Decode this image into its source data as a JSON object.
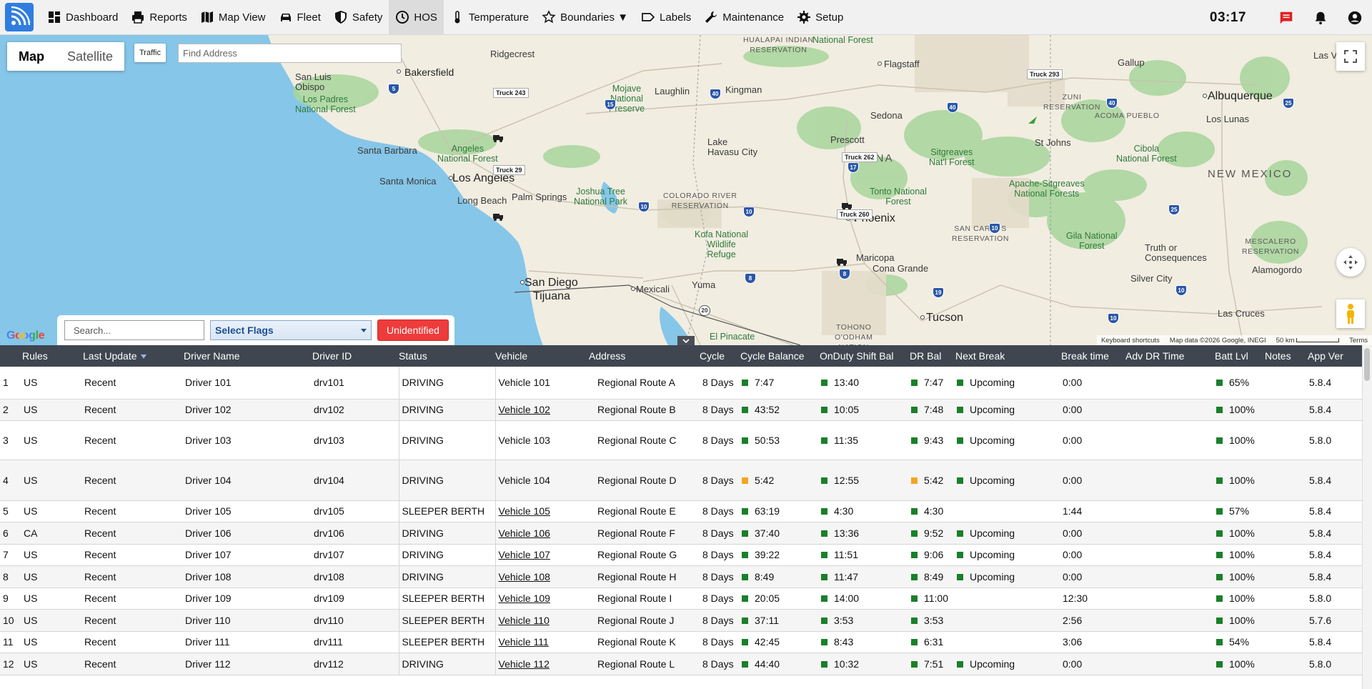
{
  "nav": {
    "items": [
      {
        "id": "dashboard",
        "label": "Dashboard",
        "icon": "dashboard-icon"
      },
      {
        "id": "reports",
        "label": "Reports",
        "icon": "printer-icon"
      },
      {
        "id": "mapview",
        "label": "Map View",
        "icon": "map-icon"
      },
      {
        "id": "fleet",
        "label": "Fleet",
        "icon": "car-icon"
      },
      {
        "id": "safety",
        "label": "Safety",
        "icon": "shield-icon"
      },
      {
        "id": "hos",
        "label": "HOS",
        "icon": "clock-icon"
      },
      {
        "id": "temperature",
        "label": "Temperature",
        "icon": "thermometer-icon"
      },
      {
        "id": "boundaries",
        "label": "Boundaries ▼",
        "icon": "star-icon"
      },
      {
        "id": "labels",
        "label": "Labels",
        "icon": "label-icon"
      },
      {
        "id": "maintenance",
        "label": "Maintenance",
        "icon": "wrench-icon"
      },
      {
        "id": "setup",
        "label": "Setup",
        "icon": "gear-icon"
      }
    ],
    "active": "hos",
    "clock": "03:17",
    "accent": "#2f7de1"
  },
  "map": {
    "toggle": {
      "map": "Map",
      "satellite": "Satellite"
    },
    "traffic": "Traffic",
    "find_address_placeholder": "Find Address",
    "google": "Google",
    "attribution": {
      "shortcuts": "Keyboard shortcuts",
      "data": "Map data ©2026 Google, INEGI",
      "scale": "50 km",
      "terms": "Terms"
    },
    "trucks": [
      {
        "name": "Truck 243"
      },
      {
        "name": "Truck 29"
      },
      {
        "name": "Truck 293"
      },
      {
        "name": "Truck 262"
      },
      {
        "name": "Truck 260"
      }
    ],
    "labels": {
      "bakersfield": "Bakersfield",
      "ridgecrest": "Ridgecrest",
      "sanluis": "San Luis\nObispo",
      "lospadres": "Los Padres\nNational Forest",
      "santabarbara": "Santa Barbara",
      "angeles": "Angeles\nNational Forest",
      "losangeles": "Los Angeles",
      "santamonica": "Santa Monica",
      "longbeach": "Long Beach",
      "palmsprings": "Palm Springs",
      "joshua": "Joshua Tree\nNational Park",
      "mojave": "Mojave\nNational\nPreserve",
      "laughlin": "Laughlin",
      "kingman": "Kingman",
      "lakehavasu": "Lake\nHavasu City",
      "coloradoriver": "COLORADO RIVER\nRESERVATION",
      "kofa": "Kofa National\nWildlife\nRefuge",
      "sandiego": "San Diego",
      "tijuana": "Tijuana",
      "mexicali": "Mexicali",
      "yuma": "Yuma",
      "elpinacate": "El Pinacate",
      "hualapai": "HUALAPAI INDIAN\nRESERVATION",
      "flagstaff": "Flagstaff",
      "sedona": "Sedona",
      "prescott": "Prescott",
      "arizona": "ONA",
      "tonto": "Tonto National\nForest",
      "sitgreaves": "Sitgreaves\nNat'l Forest",
      "phoenix": "Phoenix",
      "maricopa": "Maricopa",
      "casagrande": "Cona Grande",
      "tucson": "Tucson",
      "tohono": "TOHONO\nO'ODHAM\nNATION",
      "sancarlos": "SAN CARLOS\nRESERVATION",
      "apache": "Apache-Sitgreaves\nNational Forests",
      "stjohns": "St Johns",
      "zuni": "ZUNI\nRESERVATION",
      "gallup": "Gallup",
      "acomapueblo": "ACOMA PUEBLO",
      "albuquerque": "Albuquerque",
      "loslunas": "Los Lunas",
      "cibola": "Cibola\nNational Forest",
      "newmexico": "NEW MEXICO",
      "gila": "Gila National\nForest",
      "truth": "Truth or\nConsequences",
      "silvercity": "Silver City",
      "lascruces": "Las Cruces",
      "mescalero": "MESCALERO\nRESERVATION",
      "alamogordo": "Alamogordo",
      "nationalforest": "National Forest",
      "reservation": "RESERVATION",
      "lasvegas": "Las Vega"
    },
    "highways": [
      "5",
      "40",
      "15",
      "10",
      "8",
      "17",
      "19",
      "25",
      "20",
      "40",
      "10",
      "17"
    ]
  },
  "filters": {
    "search_placeholder": "Search...",
    "select_flags": "Select Flags",
    "unidentified": "Unidentified"
  },
  "table": {
    "columns": [
      "",
      "Rules",
      "Last Update",
      "Driver Name",
      "Driver ID",
      "Status",
      "Vehicle",
      "Address",
      "Cycle",
      "Cycle Balance",
      "OnDuty Shift Bal",
      "DR Bal",
      "Next Break",
      "Break time",
      "Adv DR Time",
      "Batt Lvl",
      "Notes",
      "App Ver"
    ],
    "status_colors": {
      "ok": "#1a7f2a",
      "warn": "#f4a522"
    },
    "rows": [
      {
        "n": "1",
        "rules": "US",
        "update": "Recent",
        "driver": "Driver 101",
        "id": "drv101",
        "status": "DRIVING",
        "vehicle": "Vehicle 101",
        "vlink": false,
        "address": "Regional Route A",
        "cycle": "8 Days",
        "cycle_bal": "7:47",
        "cb_warn": false,
        "onduty": "13:40",
        "dr_bal": "7:47",
        "dr_warn": false,
        "next_break": "Upcoming",
        "break_time": "0:00",
        "adv_dr": "",
        "batt": "65%",
        "notes": "",
        "ver": "5.8.4",
        "h": 45
      },
      {
        "n": "2",
        "rules": "US",
        "update": "Recent",
        "driver": "Driver 102",
        "id": "drv102",
        "status": "DRIVING",
        "vehicle": "Vehicle 102",
        "vlink": true,
        "address": "Regional Route B",
        "cycle": "8 Days",
        "cycle_bal": "43:52",
        "cb_warn": false,
        "onduty": "10:05",
        "dr_bal": "7:48",
        "dr_warn": false,
        "next_break": "Upcoming",
        "break_time": "0:00",
        "adv_dr": "",
        "batt": "100%",
        "notes": "",
        "ver": "5.8.4",
        "h": 30
      },
      {
        "n": "3",
        "rules": "US",
        "update": "Recent",
        "driver": "Driver 103",
        "id": "drv103",
        "status": "DRIVING",
        "vehicle": "Vehicle 103",
        "vlink": false,
        "address": "Regional Route C",
        "cycle": "8 Days",
        "cycle_bal": "50:53",
        "cb_warn": false,
        "onduty": "11:35",
        "dr_bal": "9:43",
        "dr_warn": false,
        "next_break": "Upcoming",
        "break_time": "0:00",
        "adv_dr": "",
        "batt": "100%",
        "notes": "",
        "ver": "5.8.0",
        "h": 55
      },
      {
        "n": "4",
        "rules": "US",
        "update": "Recent",
        "driver": "Driver 104",
        "id": "drv104",
        "status": "DRIVING",
        "vehicle": "Vehicle 104",
        "vlink": false,
        "address": "Regional Route D",
        "cycle": "8 Days",
        "cycle_bal": "5:42",
        "cb_warn": true,
        "onduty": "12:55",
        "dr_bal": "5:42",
        "dr_warn": true,
        "next_break": "Upcoming",
        "break_time": "0:00",
        "adv_dr": "",
        "batt": "100%",
        "notes": "",
        "ver": "5.8.4",
        "h": 57
      },
      {
        "n": "5",
        "rules": "US",
        "update": "Recent",
        "driver": "Driver 105",
        "id": "drv105",
        "status": "SLEEPER BERTH",
        "vehicle": "Vehicle 105",
        "vlink": true,
        "address": "Regional Route E",
        "cycle": "8 Days",
        "cycle_bal": "63:19",
        "cb_warn": false,
        "onduty": "4:30",
        "dr_bal": "4:30",
        "dr_warn": false,
        "next_break": "",
        "break_time": "1:44",
        "adv_dr": "",
        "batt": "57%",
        "notes": "",
        "ver": "5.8.4",
        "h": 30
      },
      {
        "n": "6",
        "rules": "CA",
        "update": "Recent",
        "driver": "Driver 106",
        "id": "drv106",
        "status": "DRIVING",
        "vehicle": "Vehicle 106",
        "vlink": true,
        "address": "Regional Route F",
        "cycle": "8 Days",
        "cycle_bal": "37:40",
        "cb_warn": false,
        "onduty": "13:36",
        "dr_bal": "9:52",
        "dr_warn": false,
        "next_break": "Upcoming",
        "break_time": "0:00",
        "adv_dr": "",
        "batt": "100%",
        "notes": "",
        "ver": "5.8.4",
        "h": 31
      },
      {
        "n": "7",
        "rules": "US",
        "update": "Recent",
        "driver": "Driver 107",
        "id": "drv107",
        "status": "DRIVING",
        "vehicle": "Vehicle 107",
        "vlink": true,
        "address": "Regional Route G",
        "cycle": "8 Days",
        "cycle_bal": "39:22",
        "cb_warn": false,
        "onduty": "11:51",
        "dr_bal": "9:06",
        "dr_warn": false,
        "next_break": "Upcoming",
        "break_time": "0:00",
        "adv_dr": "",
        "batt": "100%",
        "notes": "",
        "ver": "5.8.4",
        "h": 30
      },
      {
        "n": "8",
        "rules": "US",
        "update": "Recent",
        "driver": "Driver 108",
        "id": "drv108",
        "status": "DRIVING",
        "vehicle": "Vehicle 108",
        "vlink": true,
        "address": "Regional Route H",
        "cycle": "8 Days",
        "cycle_bal": "8:49",
        "cb_warn": false,
        "onduty": "11:47",
        "dr_bal": "8:49",
        "dr_warn": false,
        "next_break": "Upcoming",
        "break_time": "0:00",
        "adv_dr": "",
        "batt": "100%",
        "notes": "",
        "ver": "5.8.4",
        "h": 31
      },
      {
        "n": "9",
        "rules": "US",
        "update": "Recent",
        "driver": "Driver 109",
        "id": "drv109",
        "status": "SLEEPER BERTH",
        "vehicle": "Vehicle 109",
        "vlink": true,
        "address": "Regional Route I",
        "cycle": "8 Days",
        "cycle_bal": "20:05",
        "cb_warn": false,
        "onduty": "14:00",
        "dr_bal": "11:00",
        "dr_warn": false,
        "next_break": "",
        "break_time": "12:30",
        "adv_dr": "",
        "batt": "100%",
        "notes": "",
        "ver": "5.8.0",
        "h": 30
      },
      {
        "n": "10",
        "rules": "US",
        "update": "Recent",
        "driver": "Driver 110",
        "id": "drv110",
        "status": "SLEEPER BERTH",
        "vehicle": "Vehicle 110",
        "vlink": true,
        "address": "Regional Route J",
        "cycle": "8 Days",
        "cycle_bal": "37:11",
        "cb_warn": false,
        "onduty": "3:53",
        "dr_bal": "3:53",
        "dr_warn": false,
        "next_break": "",
        "break_time": "2:56",
        "adv_dr": "",
        "batt": "100%",
        "notes": "",
        "ver": "5.7.6",
        "h": 31
      },
      {
        "n": "11",
        "rules": "US",
        "update": "Recent",
        "driver": "Driver 111",
        "id": "drv111",
        "status": "SLEEPER BERTH",
        "vehicle": "Vehicle 111",
        "vlink": true,
        "address": "Regional Route K",
        "cycle": "8 Days",
        "cycle_bal": "42:45",
        "cb_warn": false,
        "onduty": "8:43",
        "dr_bal": "6:31",
        "dr_warn": false,
        "next_break": "",
        "break_time": "3:06",
        "adv_dr": "",
        "batt": "54%",
        "notes": "",
        "ver": "5.8.4",
        "h": 30
      },
      {
        "n": "12",
        "rules": "US",
        "update": "Recent",
        "driver": "Driver 112",
        "id": "drv112",
        "status": "DRIVING",
        "vehicle": "Vehicle 112",
        "vlink": true,
        "address": "Regional Route L",
        "cycle": "8 Days",
        "cycle_bal": "44:40",
        "cb_warn": false,
        "onduty": "10:32",
        "dr_bal": "7:51",
        "dr_warn": false,
        "next_break": "Upcoming",
        "break_time": "0:00",
        "adv_dr": "",
        "batt": "100%",
        "notes": "",
        "ver": "5.8.0",
        "h": 31
      }
    ]
  }
}
